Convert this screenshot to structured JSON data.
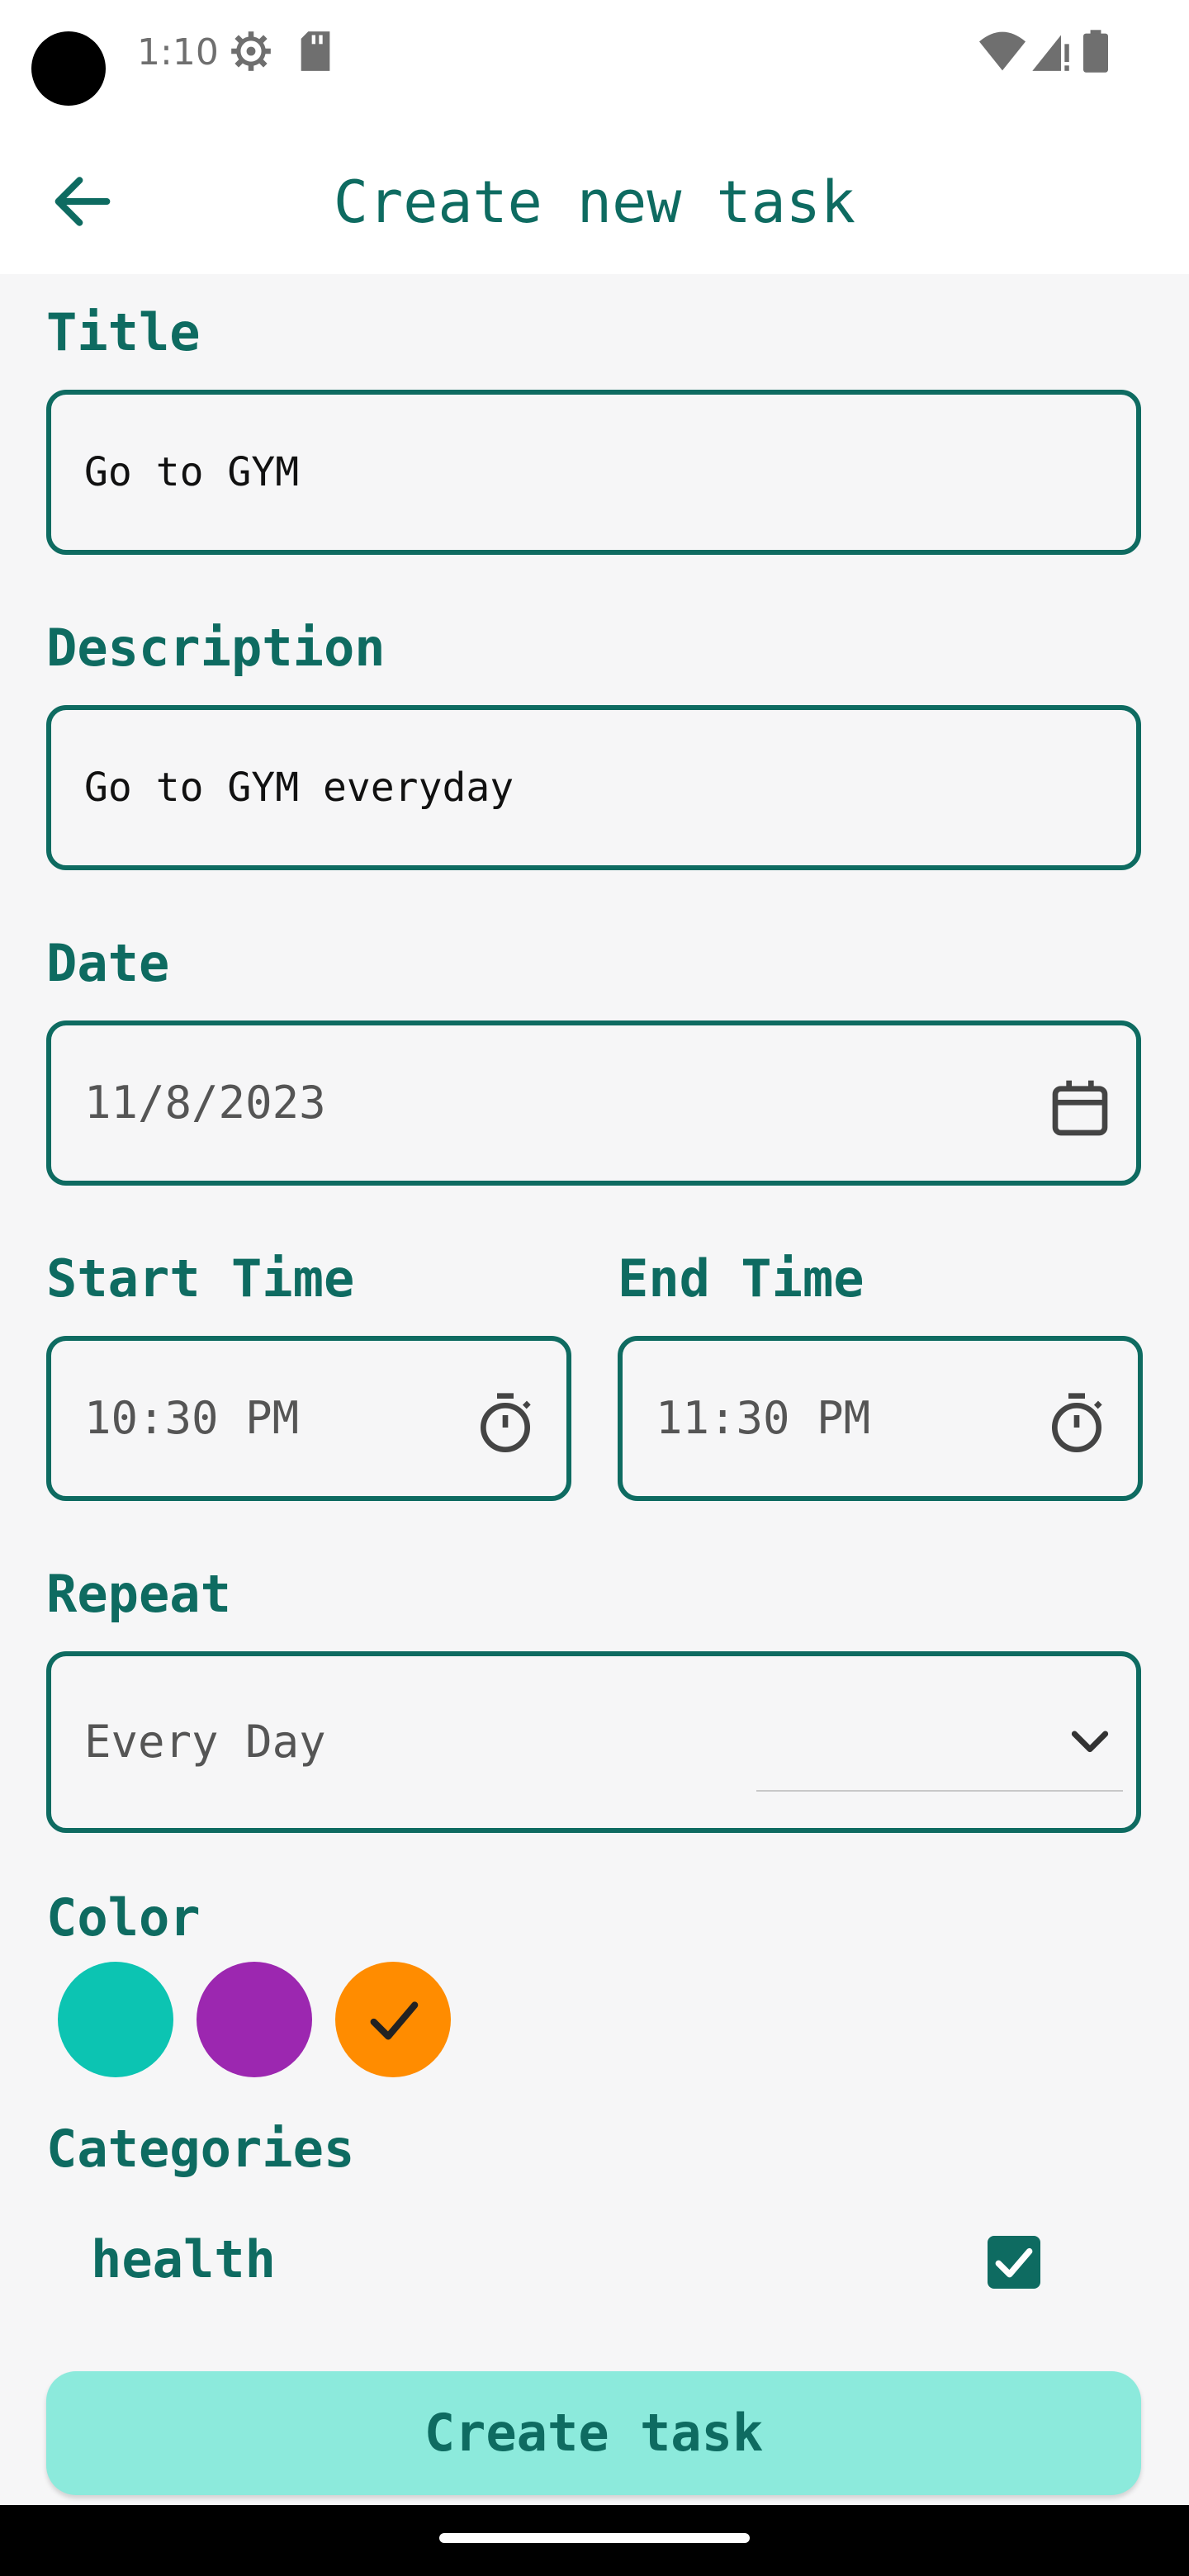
{
  "status_bar": {
    "time": "1:10"
  },
  "app_bar": {
    "title": "Create new task"
  },
  "form": {
    "title": {
      "label": "Title",
      "value": "Go to GYM"
    },
    "description": {
      "label": "Description",
      "value": "Go to GYM everyday"
    },
    "date": {
      "label": "Date",
      "value": "11/8/2023"
    },
    "start_time": {
      "label": "Start Time",
      "value": "10:30 PM"
    },
    "end_time": {
      "label": "End Time",
      "value": "11:30 PM"
    },
    "repeat": {
      "label": "Repeat",
      "value": "Every Day"
    },
    "color": {
      "label": "Color",
      "options": [
        "#0cc4b2",
        "#9c27b0",
        "#ff8c00"
      ],
      "selected_index": 2
    },
    "categories": {
      "label": "Categories",
      "items": [
        {
          "name": "health",
          "checked": true
        }
      ]
    }
  },
  "actions": {
    "create_label": "Create task"
  },
  "colors": {
    "accent": "#0e6b61",
    "button_bg": "#8ceadc"
  }
}
